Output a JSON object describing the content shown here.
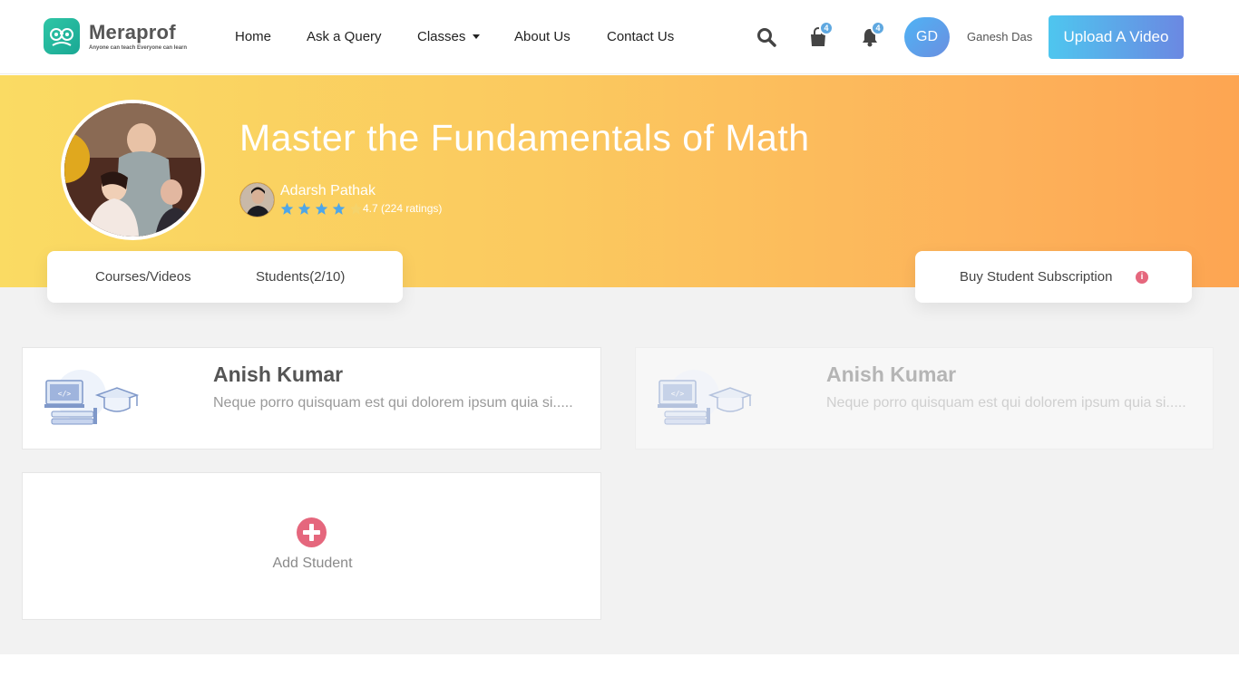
{
  "brand": {
    "name": "Meraprof",
    "tagline": "Anyone can teach Everyone can learn"
  },
  "nav": {
    "home": "Home",
    "ask": "Ask a Query",
    "classes": "Classes",
    "about": "About Us",
    "contact": "Contact Us"
  },
  "header": {
    "cart_count": "4",
    "notif_count": "4",
    "avatar_initials": "GD",
    "user_name": "Ganesh Das",
    "upload_label": "Upload A Video"
  },
  "course": {
    "title": "Master the Fundamentals of Math",
    "instructor": "Adarsh Pathak",
    "rating_value": 4.7,
    "rating_text": "4.7 (224 ratings)"
  },
  "tabs": {
    "courses": "Courses/Videos",
    "students": "Students(2/10)"
  },
  "subscription": {
    "label": "Buy Student Subscription",
    "info": "i"
  },
  "students": [
    {
      "name": "Anish Kumar",
      "desc": "Neque porro quisquam est qui dolorem ipsum quia si....."
    },
    {
      "name": "Anish Kumar",
      "desc": "Neque porro quisquam est qui dolorem ipsum quia si....."
    }
  ],
  "add_student": {
    "label": "Add Student"
  },
  "colors": {
    "accent_blue": "#5fa8e0",
    "accent_pink": "#e5677d",
    "hero_start": "#fadb63",
    "hero_end": "#fda552",
    "brand_green": "#1aa894"
  }
}
